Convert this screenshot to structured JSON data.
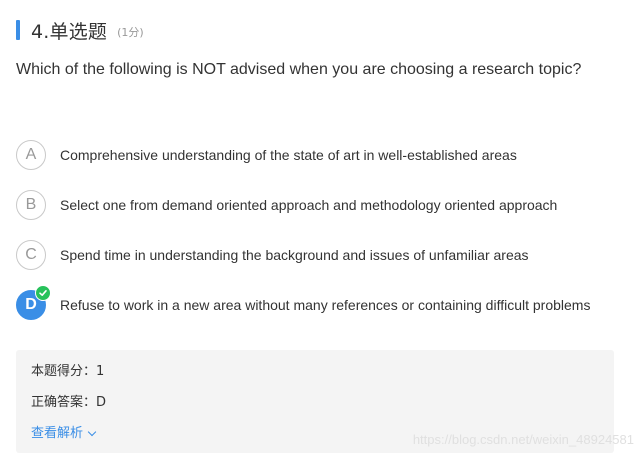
{
  "question": {
    "title": "4.单选题",
    "score": "(1分)",
    "text": "Which of the following is NOT advised when you are choosing a research topic?"
  },
  "options": [
    {
      "letter": "A",
      "text": "Comprehensive understanding of the state of art in well-established areas",
      "selected": false
    },
    {
      "letter": "B",
      "text": "Select one from demand oriented approach and methodology oriented approach",
      "selected": false
    },
    {
      "letter": "C",
      "text": "Spend time in understanding the background and issues of unfamiliar areas",
      "selected": false
    },
    {
      "letter": "D",
      "text": "Refuse to work in a new area without many references or containing difficult problems",
      "selected": true
    }
  ],
  "result": {
    "score_line": "本题得分：1",
    "answer_line": "正确答案：D",
    "analysis_link": "查看解析"
  },
  "watermark": "https://blog.csdn.net/weixin_48924581",
  "colors": {
    "accent": "#3a8ee6",
    "correct": "#27c25b",
    "panel_bg": "#f4f4f4"
  },
  "icons": {
    "check": "check-icon",
    "chevron": "chevron-down-icon"
  }
}
